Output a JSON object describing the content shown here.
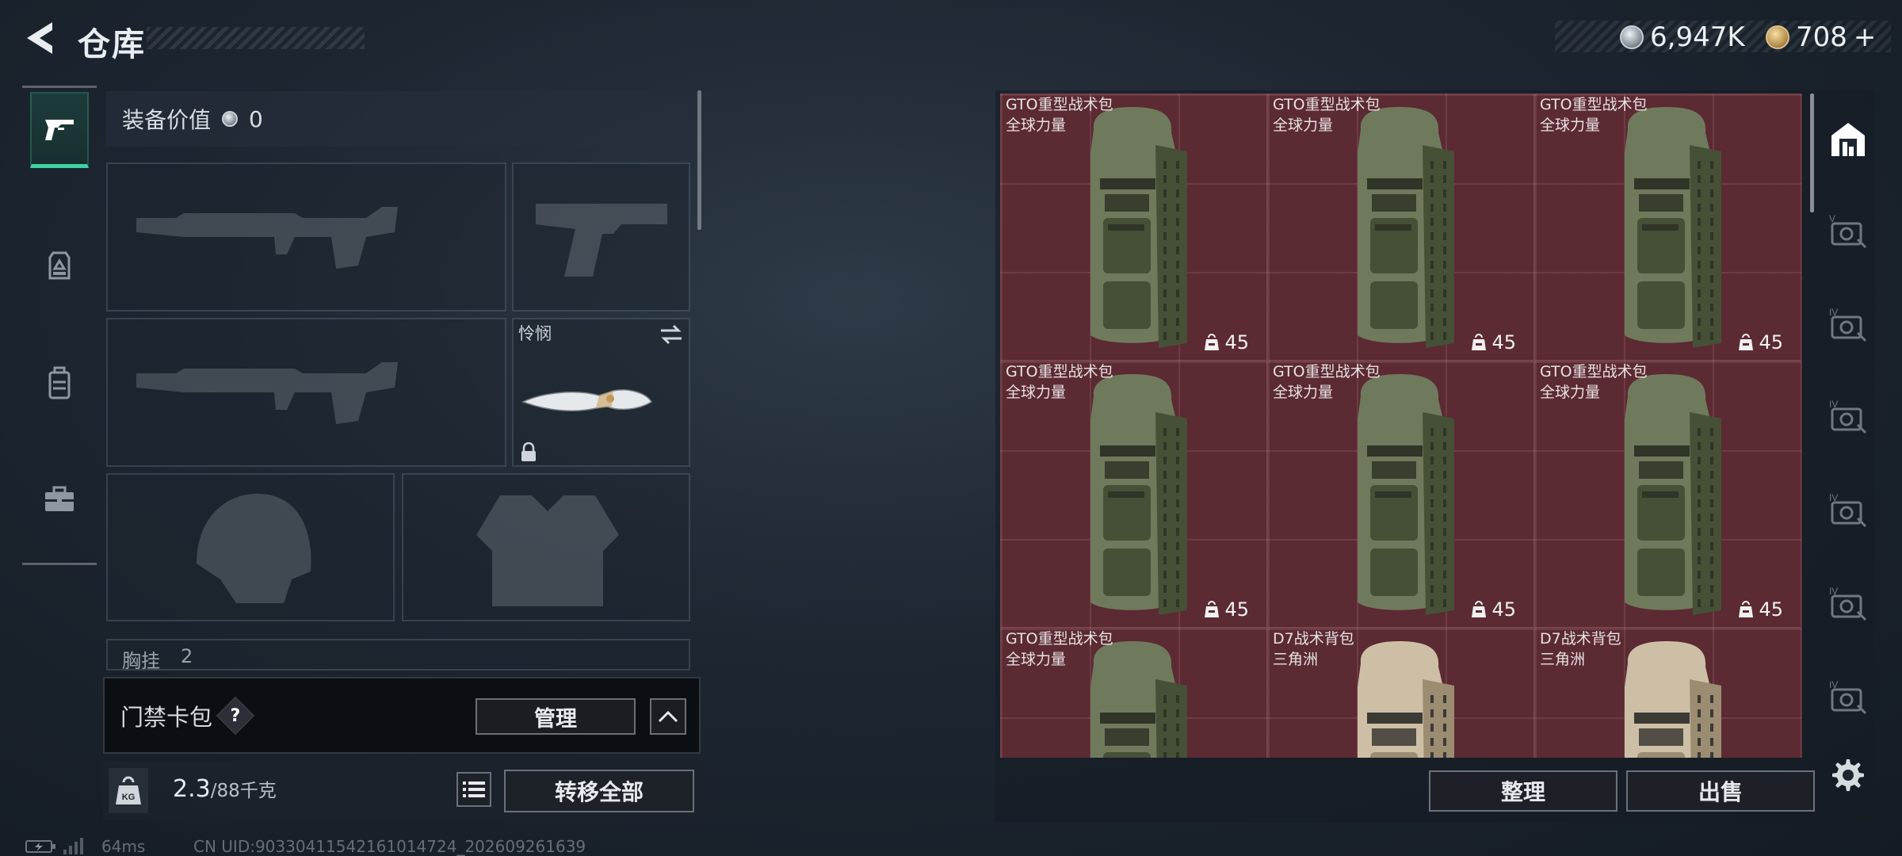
{
  "header": {
    "title": "仓库",
    "currency_silver": "6,947K",
    "currency_gold": "708",
    "currency_gold_suffix": "+",
    "accent_color": "#3fd2a0"
  },
  "left_nav": {
    "items": [
      {
        "name": "weapons",
        "icon": "pistol-icon",
        "active": true
      },
      {
        "name": "gear",
        "icon": "chest-rig-icon",
        "active": false
      },
      {
        "name": "backpack",
        "icon": "backpack-icon",
        "active": false
      },
      {
        "name": "items",
        "icon": "briefcase-icon",
        "active": false
      }
    ]
  },
  "loadout": {
    "value_label": "装备价值",
    "value_amount": "0",
    "melee_slot_label": "怜悯",
    "chest_label": "胸挂",
    "chest_count": "2"
  },
  "access_card": {
    "label": "门禁卡包",
    "help": "?",
    "manage_label": "管理"
  },
  "weight": {
    "current": "2.3",
    "max": "/88千克",
    "transfer_all_label": "转移全部"
  },
  "status_line": {
    "ping": "64ms",
    "uid": "CN UID:903304115421610147​24_202609261639"
  },
  "storage": {
    "cells": [
      {
        "name": "GTO重型战术包",
        "faction": "全球力量",
        "capacity": "45",
        "color": "green"
      },
      {
        "name": "GTO重型战术包",
        "faction": "全球力量",
        "capacity": "45",
        "color": "green"
      },
      {
        "name": "GTO重型战术包",
        "faction": "全球力量",
        "capacity": "45",
        "color": "green"
      },
      {
        "name": "GTO重型战术包",
        "faction": "全球力量",
        "capacity": "45",
        "color": "green"
      },
      {
        "name": "GTO重型战术包",
        "faction": "全球力量",
        "capacity": "45",
        "color": "green"
      },
      {
        "name": "GTO重型战术包",
        "faction": "全球力量",
        "capacity": "45",
        "color": "green"
      },
      {
        "name": "GTO重型战术包",
        "faction": "全球力量",
        "capacity": "",
        "color": "green"
      },
      {
        "name": "D7战术背包",
        "faction": "三角洲",
        "capacity": "",
        "color": "tan"
      },
      {
        "name": "D7战术背包",
        "faction": "三角洲",
        "capacity": "",
        "color": "tan"
      }
    ],
    "sort_label": "整理",
    "sell_label": "出售",
    "cell_bg": "#5b2a32"
  },
  "category_rail": {
    "items": [
      {
        "icon": "home-shelter-icon",
        "tier": ""
      },
      {
        "icon": "helmet-tier-icon",
        "tier": "V"
      },
      {
        "icon": "armor-tier-icon",
        "tier": "IV"
      },
      {
        "icon": "helmet-tier-icon",
        "tier": "IV"
      },
      {
        "icon": "rig-tier-icon",
        "tier": "IV"
      },
      {
        "icon": "weapon-tier-icon",
        "tier": "IV"
      },
      {
        "icon": "weapon-tier-icon",
        "tier": "IV"
      }
    ]
  }
}
